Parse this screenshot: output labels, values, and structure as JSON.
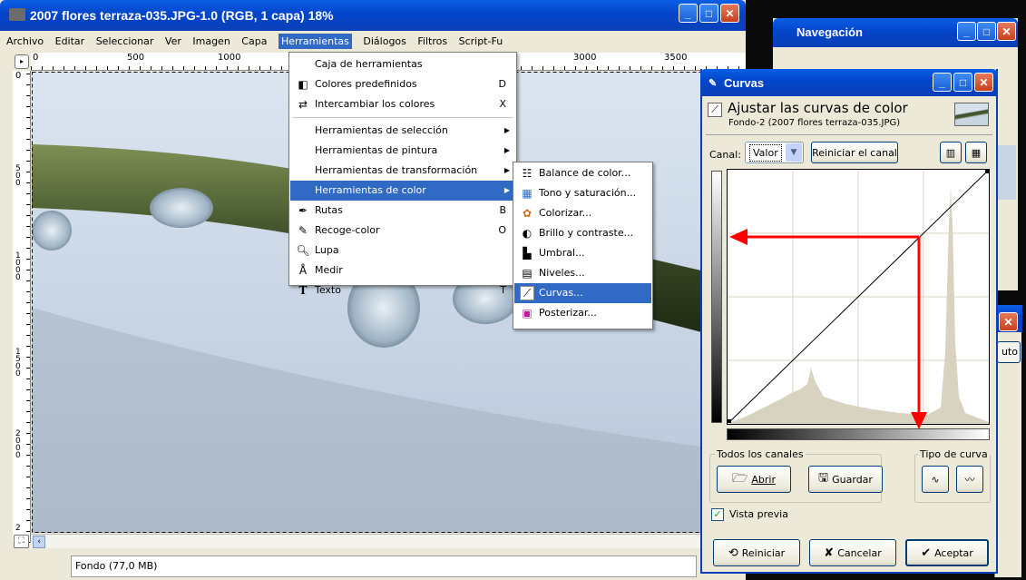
{
  "image_window": {
    "title": "2007 flores terraza-035.JPG-1.0 (RGB, 1 capa) 18%",
    "menu": [
      "Archivo",
      "Editar",
      "Seleccionar",
      "Ver",
      "Imagen",
      "Capa",
      "Herramientas",
      "Diálogos",
      "Filtros",
      "Script-Fu"
    ],
    "ruler_top": [
      "0",
      "500",
      "1000",
      "3000",
      "3500"
    ],
    "ruler_left": [
      "0",
      "5\n0\n0",
      "1\n0\n0\n0",
      "1\n5\n0\n0",
      "2\n0\n0\n0",
      "2"
    ],
    "status": "Fondo (77,0 MB)"
  },
  "herramientas_menu": {
    "items": [
      {
        "label": "Caja de herramientas",
        "shortcut": "",
        "icon": ""
      },
      {
        "label": "Colores predefinidos",
        "shortcut": "D",
        "icon": "default-colors-icon"
      },
      {
        "label": "Intercambiar los colores",
        "shortcut": "X",
        "icon": "swap-colors-icon"
      },
      {
        "label": "Herramientas de selección",
        "submenu": true
      },
      {
        "label": "Herramientas de pintura",
        "submenu": true
      },
      {
        "label": "Herramientas de transformación",
        "submenu": true
      },
      {
        "label": "Herramientas de color",
        "submenu": true,
        "selected": true
      },
      {
        "label": "Rutas",
        "shortcut": "B",
        "icon": "paths-icon"
      },
      {
        "label": "Recoge-color",
        "shortcut": "O",
        "icon": "color-picker-icon"
      },
      {
        "label": "Lupa",
        "shortcut": "",
        "icon": "magnify-icon"
      },
      {
        "label": "Medir",
        "shortcut": "",
        "icon": "measure-icon"
      },
      {
        "label": "Texto",
        "shortcut": "T",
        "icon": "text-icon"
      }
    ]
  },
  "color_submenu": {
    "items": [
      "Balance de color...",
      "Tono y saturación...",
      "Colorizar...",
      "Brillo y contraste...",
      "Umbral...",
      "Niveles...",
      "Curvas...",
      "Posterizar..."
    ],
    "selected_index": 6
  },
  "navegacion": {
    "title": "Navegación"
  },
  "right_partial": {
    "auto_label": "uto"
  },
  "curvas": {
    "title": "Curvas",
    "header": "Ajustar las curvas de color",
    "subheader": "Fondo-2 (2007 flores terraza-035.JPG)",
    "canal_label": "Canal:",
    "canal_value": "Valor",
    "reset_channel": "Reiniciar el canal",
    "todos_canales": "Todos los canales",
    "abrir": "Abrir",
    "guardar": "Guardar",
    "tipo_curva": "Tipo de curva",
    "vista_previa": "Vista previa",
    "reiniciar": "Reiniciar",
    "cancelar": "Cancelar",
    "aceptar": "Aceptar",
    "accent": "#ff0000"
  }
}
